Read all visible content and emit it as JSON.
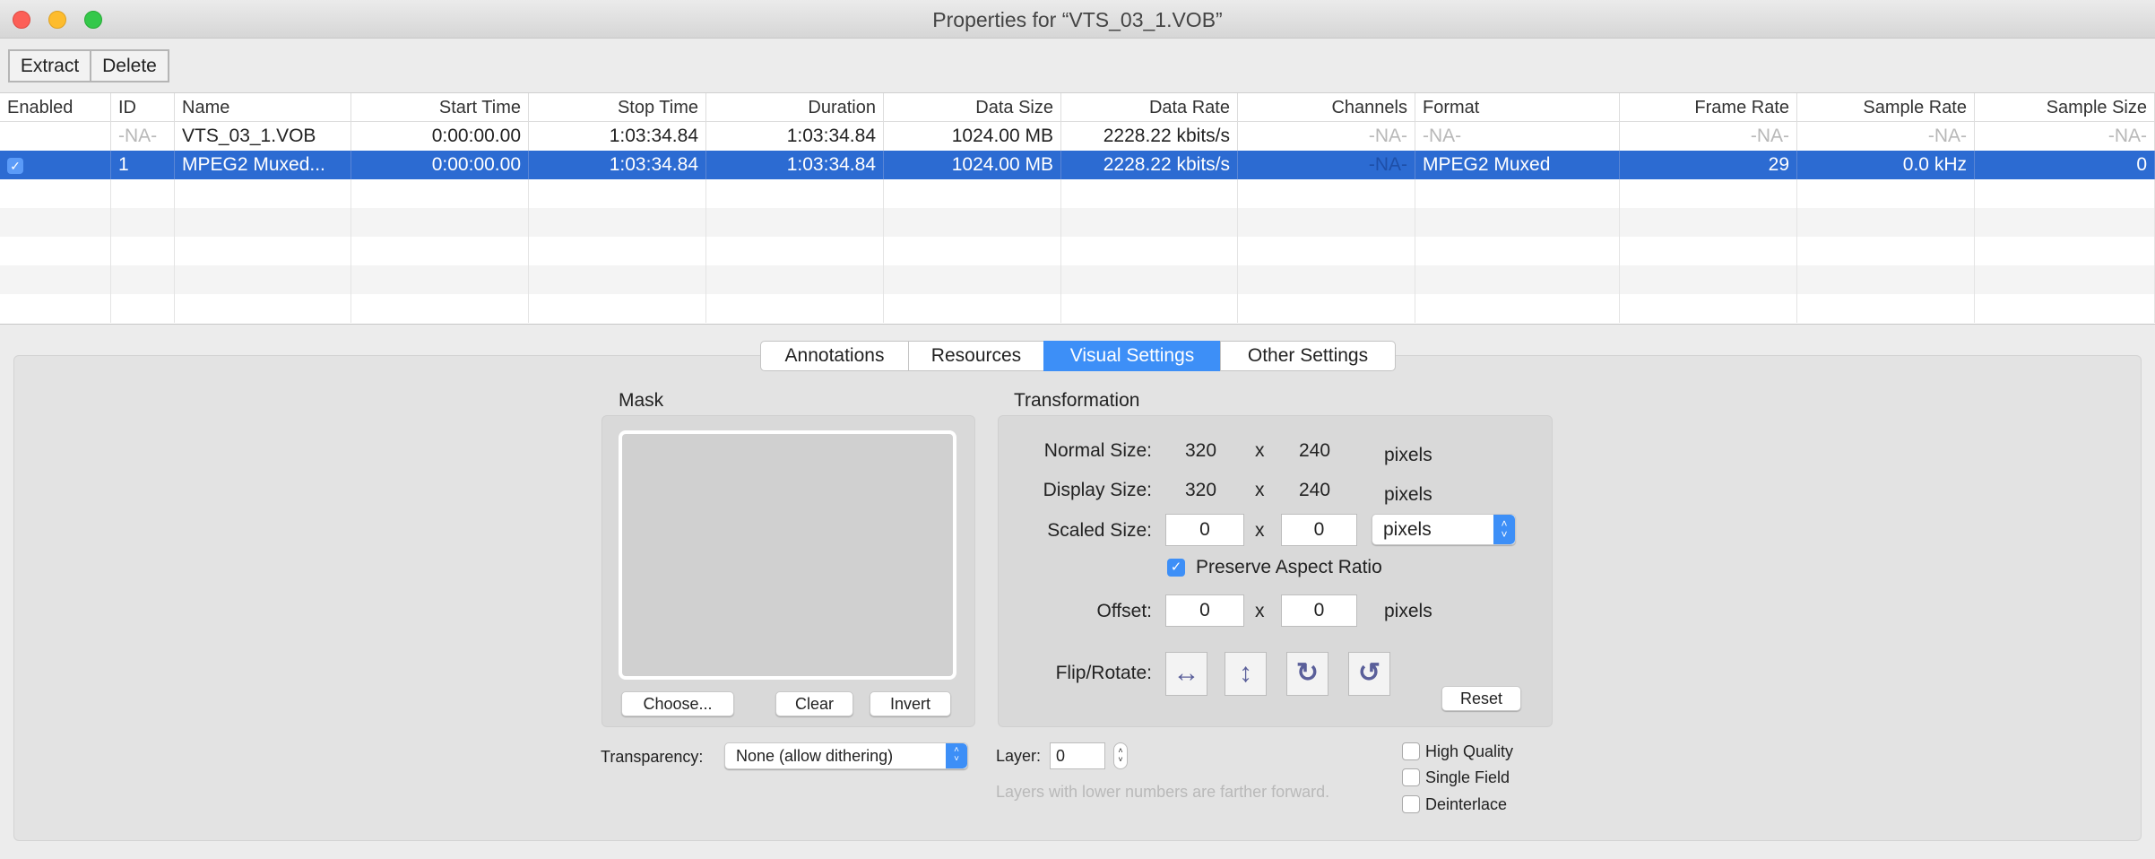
{
  "window": {
    "title": "Properties for “VTS_03_1.VOB”"
  },
  "toolbar": {
    "extract": "Extract",
    "delete": "Delete"
  },
  "table": {
    "columns": [
      "Enabled",
      "ID",
      "Name",
      "Start Time",
      "Stop Time",
      "Duration",
      "Data Size",
      "Data Rate",
      "Channels",
      "Format",
      "Frame Rate",
      "Sample Rate",
      "Sample Size"
    ],
    "rows": [
      {
        "enabled": "",
        "id": "-NA-",
        "name": "VTS_03_1.VOB",
        "start": "0:00:00.00",
        "stop": "1:03:34.84",
        "duration": "1:03:34.84",
        "size": "1024.00 MB",
        "rate": "2228.22 kbits/s",
        "channels": "-NA-",
        "format": "-NA-",
        "frame_rate": "-NA-",
        "sample_rate": "-NA-",
        "sample_size": "-NA-"
      },
      {
        "enabled": "✓",
        "id": "1",
        "name": "MPEG2 Muxed...",
        "start": "0:00:00.00",
        "stop": "1:03:34.84",
        "duration": "1:03:34.84",
        "size": "1024.00 MB",
        "rate": "2228.22 kbits/s",
        "channels": "-NA-",
        "format": "MPEG2 Muxed",
        "frame_rate": "29",
        "sample_rate": "0.0 kHz",
        "sample_size": "0"
      }
    ]
  },
  "tabs": [
    "Annotations",
    "Resources",
    "Visual Settings",
    "Other Settings"
  ],
  "mask": {
    "title": "Mask",
    "choose": "Choose...",
    "clear": "Clear",
    "invert": "Invert"
  },
  "transform": {
    "title": "Transformation",
    "normal_label": "Normal Size:",
    "normal_w": "320",
    "normal_h": "240",
    "display_label": "Display Size:",
    "display_w": "320",
    "display_h": "240",
    "scaled_label": "Scaled Size:",
    "scaled_w": "0",
    "scaled_h": "0",
    "unit_select": "pixels",
    "x": "x",
    "pixels": "pixels",
    "preserve": "Preserve Aspect Ratio",
    "offset_label": "Offset:",
    "offset_x": "0",
    "offset_y": "0",
    "flip_label": "Flip/Rotate:",
    "reset": "Reset"
  },
  "bottom": {
    "transparency_label": "Transparency:",
    "transparency_value": "None (allow dithering)",
    "layer_label": "Layer:",
    "layer_value": "0",
    "layer_hint": "Layers with lower numbers are farther forward.",
    "high_quality": "High Quality",
    "single_field": "Single Field",
    "deinterlace": "Deinterlace"
  },
  "colors": {
    "selection": "#2c6bd2",
    "accent": "#3d8ff7"
  }
}
